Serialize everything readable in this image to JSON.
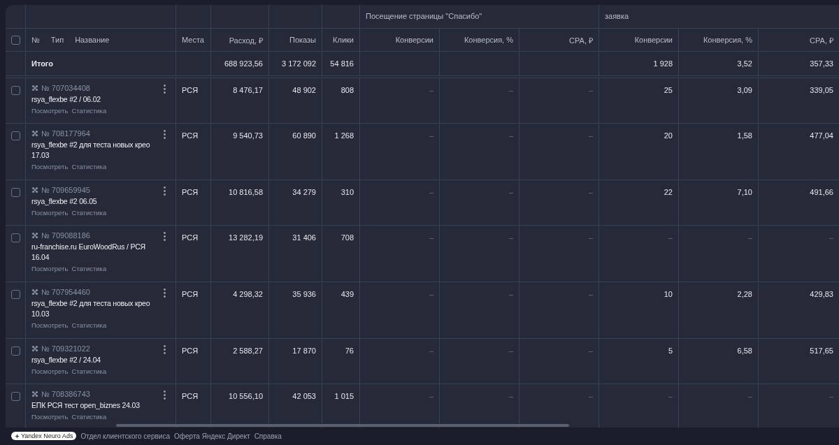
{
  "group_headers": [
    {
      "label": "Посещение страницы \"Спасибо\""
    },
    {
      "label": "заявка"
    }
  ],
  "header": {
    "checked": false,
    "number": "№",
    "type": "Тип",
    "name": "Название",
    "columns": [
      "Места",
      "Расход, ₽",
      "Показы",
      "Клики",
      "Конверсии",
      "Конверсия, %",
      "CPA, ₽",
      "Конверсии",
      "Конверсия, %",
      "CPA, ₽"
    ]
  },
  "total": {
    "label": "Итого",
    "spend": "688 923,56",
    "impressions": "3 172 092",
    "clicks": "54 816",
    "request_conversions": "1 928",
    "request_rate": "3,52",
    "request_cpa": "357,33"
  },
  "rows": [
    {
      "checked": false,
      "number": "№ 707034408",
      "name": "rsya_flexbe #2 / 06.02",
      "links": [
        "Посмотреть",
        "Статистика"
      ],
      "values": [
        "РСЯ",
        "8 476,17",
        "48 902",
        "808",
        "–",
        "–",
        "–",
        "25",
        "3,09",
        "339,05"
      ]
    },
    {
      "checked": false,
      "number": "№ 708177964",
      "name": "rsya_flexbe #2 для теста новых крео 17.03",
      "links": [
        "Посмотреть",
        "Статистика"
      ],
      "values": [
        "РСЯ",
        "9 540,73",
        "60 890",
        "1 268",
        "–",
        "–",
        "–",
        "20",
        "1,58",
        "477,04"
      ]
    },
    {
      "checked": false,
      "number": "№ 709659945",
      "name": "rsya_flexbe #2 06.05",
      "links": [
        "Посмотреть",
        "Статистика"
      ],
      "values": [
        "РСЯ",
        "10 816,58",
        "34 279",
        "310",
        "–",
        "–",
        "–",
        "22",
        "7,10",
        "491,66"
      ]
    },
    {
      "checked": false,
      "number": "№ 709088186",
      "name": "ru-franchise.ru EuroWoodRus / РСЯ 16.04",
      "links": [
        "Посмотреть",
        "Статистика"
      ],
      "values": [
        "РСЯ",
        "13 282,19",
        "31 406",
        "708",
        "–",
        "–",
        "–",
        "–",
        "–",
        "–"
      ]
    },
    {
      "checked": false,
      "number": "№ 707954460",
      "name": "rsya_flexbe #2 для теста новых крео 10.03",
      "links": [
        "Посмотреть",
        "Статистика"
      ],
      "values": [
        "РСЯ",
        "4 298,32",
        "35 936",
        "439",
        "–",
        "–",
        "–",
        "10",
        "2,28",
        "429,83"
      ]
    },
    {
      "checked": false,
      "number": "№ 709321022",
      "name": "rsya_flexbe #2 / 24.04",
      "links": [
        "Посмотреть",
        "Статистика"
      ],
      "values": [
        "РСЯ",
        "2 588,27",
        "17 870",
        "76",
        "–",
        "–",
        "–",
        "5",
        "6,58",
        "517,65"
      ]
    },
    {
      "checked": false,
      "number": "№ 708386743",
      "name": "ЕПК РСЯ тест open_biznes 24.03",
      "links": [
        "Посмотреть",
        "Статистика"
      ],
      "values": [
        "РСЯ",
        "10 556,10",
        "42 053",
        "1 015",
        "–",
        "–",
        "–",
        "–",
        "–",
        "–"
      ]
    }
  ],
  "footer": {
    "badge": "Yandex Neuro Ads",
    "links": [
      "Отдел клиентского сервиса",
      "Оферта Яндекс Директ",
      "Справка"
    ]
  }
}
